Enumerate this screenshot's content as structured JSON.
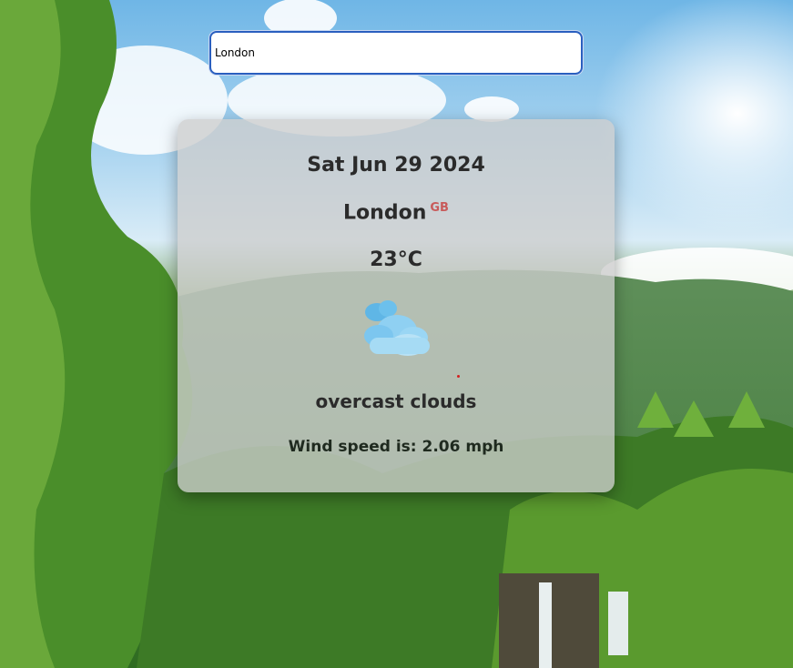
{
  "search": {
    "value": "London"
  },
  "weather": {
    "date": "Sat Jun 29 2024",
    "city": "London",
    "country": "GB",
    "temperature": "23°C",
    "icon": "cloud-icon",
    "description": "overcast clouds",
    "wind": "Wind speed is: 2.06 mph"
  },
  "colors": {
    "input_border": "#2a5fbf",
    "country_code": "#c85a5a",
    "card_background": "#cdcdcd"
  }
}
